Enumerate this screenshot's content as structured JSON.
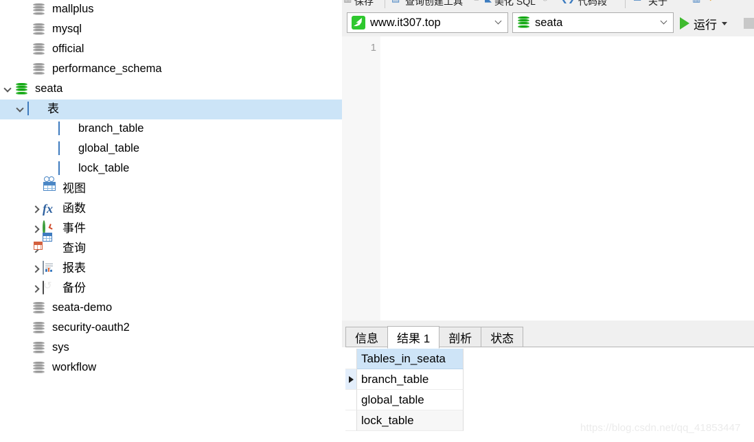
{
  "sidebar": {
    "tree": [
      {
        "label": "mallplus",
        "icon": "database-cylinder-icon",
        "indent": 47,
        "expander": "none",
        "selected": false,
        "cjk": false
      },
      {
        "label": "mysql",
        "icon": "database-cylinder-icon",
        "indent": 47,
        "expander": "none",
        "selected": false,
        "cjk": false
      },
      {
        "label": "official",
        "icon": "database-cylinder-icon",
        "indent": 47,
        "expander": "none",
        "selected": false,
        "cjk": false
      },
      {
        "label": "performance_schema",
        "icon": "database-cylinder-icon",
        "indent": 47,
        "expander": "none",
        "selected": false,
        "cjk": false
      },
      {
        "label": "seata",
        "icon": "database-active-icon",
        "indent": 22,
        "expander": "collapse",
        "selected": false,
        "cjk": false
      },
      {
        "label": "表",
        "icon": "tables-folder-icon",
        "indent": 40,
        "expander": "collapse",
        "selected": true,
        "cjk": true
      },
      {
        "label": "branch_table",
        "icon": "table-icon",
        "indent": 85,
        "expander": "none",
        "selected": false,
        "cjk": false
      },
      {
        "label": "global_table",
        "icon": "table-icon",
        "indent": 85,
        "expander": "none",
        "selected": false,
        "cjk": false
      },
      {
        "label": "lock_table",
        "icon": "table-icon",
        "indent": 85,
        "expander": "none",
        "selected": false,
        "cjk": false
      },
      {
        "label": "视图",
        "icon": "views-icon",
        "indent": 62,
        "expander": "none",
        "selected": false,
        "cjk": true
      },
      {
        "label": "函数",
        "icon": "functions-fx-icon",
        "indent": 62,
        "expander": "expand",
        "selected": false,
        "cjk": true
      },
      {
        "label": "事件",
        "icon": "events-clock-icon",
        "indent": 62,
        "expander": "expand",
        "selected": false,
        "cjk": true
      },
      {
        "label": "查询",
        "icon": "queries-icon",
        "indent": 62,
        "expander": "expand",
        "selected": false,
        "cjk": true
      },
      {
        "label": "报表",
        "icon": "reports-icon",
        "indent": 62,
        "expander": "expand",
        "selected": false,
        "cjk": true
      },
      {
        "label": "备份",
        "icon": "backups-icon",
        "indent": 62,
        "expander": "expand",
        "selected": false,
        "cjk": true
      },
      {
        "label": "seata-demo",
        "icon": "database-cylinder-icon",
        "indent": 47,
        "expander": "none",
        "selected": false,
        "cjk": false
      },
      {
        "label": "security-oauth2",
        "icon": "database-cylinder-icon",
        "indent": 47,
        "expander": "none",
        "selected": false,
        "cjk": false
      },
      {
        "label": "sys",
        "icon": "database-cylinder-icon",
        "indent": 47,
        "expander": "none",
        "selected": false,
        "cjk": false
      },
      {
        "label": "workflow",
        "icon": "database-cylinder-icon",
        "indent": 47,
        "expander": "none",
        "selected": false,
        "cjk": false
      }
    ]
  },
  "toolbar": {
    "connection": {
      "value": "www.it307.top",
      "icon": "mysql-dolphin-icon"
    },
    "database": {
      "value": "seata",
      "icon": "database-active-icon"
    },
    "run_label": "运行",
    "stop_label": ""
  },
  "editor": {
    "line_numbers": [
      "1"
    ],
    "content": ""
  },
  "results": {
    "tabs": [
      {
        "label": "信息",
        "active": false
      },
      {
        "label": "结果 1",
        "active": true
      },
      {
        "label": "剖析",
        "active": false
      },
      {
        "label": "状态",
        "active": false
      }
    ],
    "grid": {
      "columns": [
        "Tables_in_seata"
      ],
      "rows": [
        {
          "values": [
            "branch_table"
          ],
          "current": true
        },
        {
          "values": [
            "global_table"
          ],
          "current": false
        },
        {
          "values": [
            "lock_table"
          ],
          "current": false
        }
      ]
    }
  },
  "watermark": "https://blog.csdn.net/qq_41853447",
  "colors": {
    "selection": "#cce4f7",
    "active_db_green": "#11a811",
    "inactive_db_gray": "#9a9a9a",
    "table_blue": "#3e7bbf",
    "run_green": "#3fba2f",
    "panel_gray": "#f0f0f0"
  }
}
